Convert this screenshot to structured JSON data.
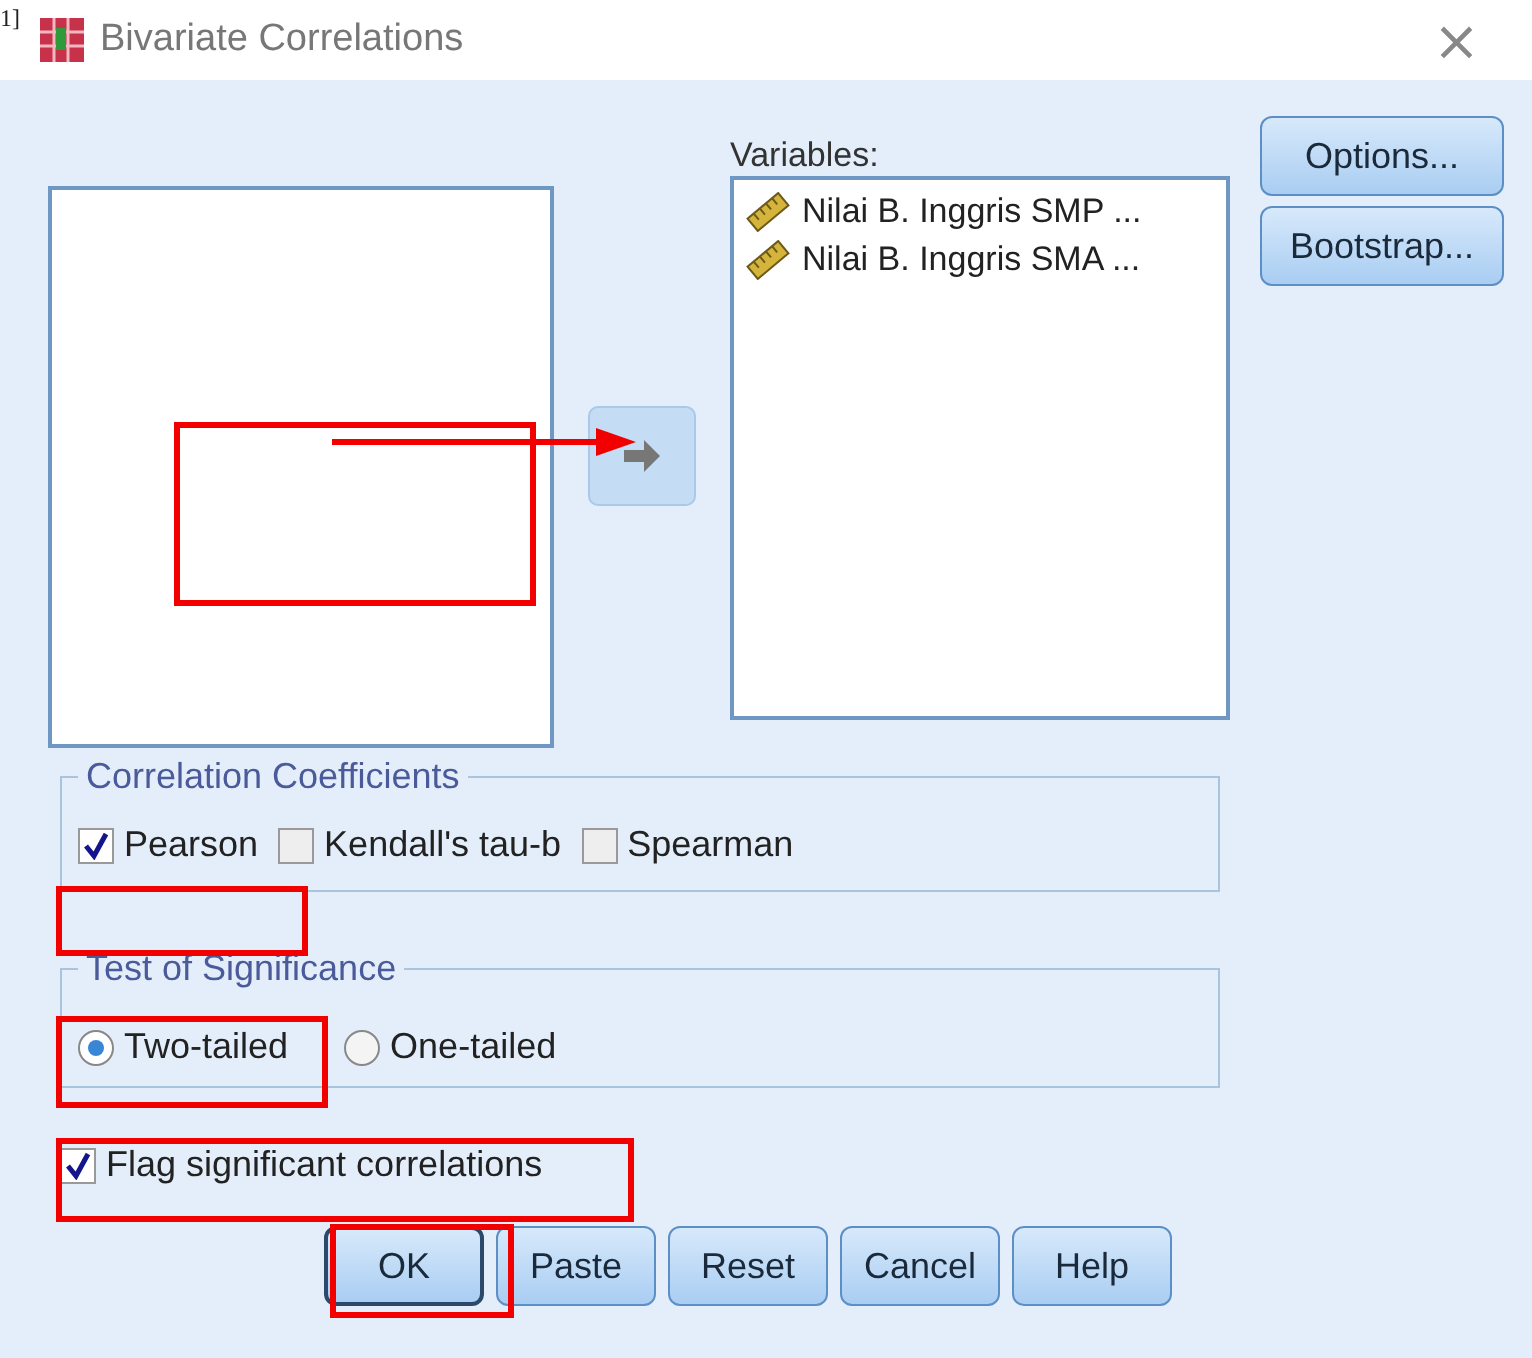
{
  "page_mark": "1]",
  "window": {
    "title": "Bivariate Correlations",
    "close": "×"
  },
  "variables": {
    "label": "Variables:",
    "items": [
      {
        "name": "Nilai B. Inggris SMP ..."
      },
      {
        "name": "Nilai B. Inggris SMA ..."
      }
    ]
  },
  "side_buttons": [
    "Options...",
    "Bootstrap..."
  ],
  "correlation_coefficients": {
    "title": "Correlation Coefficients",
    "options": [
      {
        "label": "Pearson",
        "checked": true
      },
      {
        "label": "Kendall's tau-b",
        "checked": false
      },
      {
        "label": "Spearman",
        "checked": false
      }
    ]
  },
  "test_of_significance": {
    "title": "Test of Significance",
    "options": [
      {
        "label": "Two-tailed",
        "selected": true
      },
      {
        "label": "One-tailed",
        "selected": false
      }
    ]
  },
  "flag_significant": {
    "label": "Flag significant correlations",
    "checked": true
  },
  "buttons": [
    {
      "label": "OK",
      "default": true
    },
    {
      "label": "Paste",
      "default": false
    },
    {
      "label": "Reset",
      "default": false
    },
    {
      "label": "Cancel",
      "default": false
    },
    {
      "label": "Help",
      "default": false
    }
  ]
}
